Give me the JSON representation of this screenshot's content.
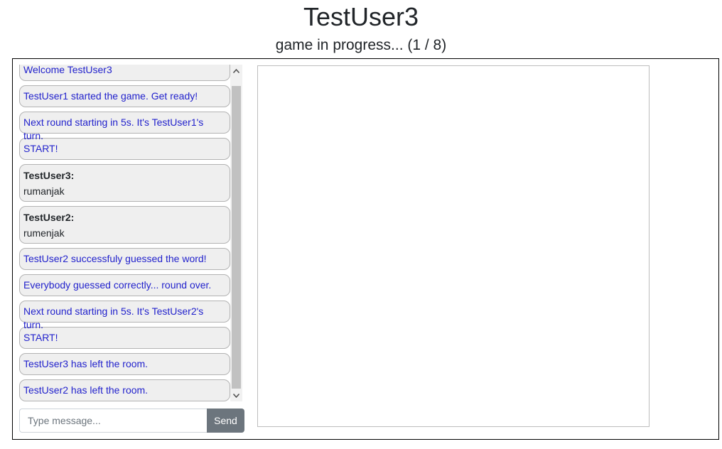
{
  "header": {
    "title": "TestUser3",
    "status": "game in progress... (1 / 8)"
  },
  "chat": {
    "messages": [
      {
        "type": "system",
        "text": "Welcome TestUser3"
      },
      {
        "type": "system",
        "text": "TestUser1 started the game. Get ready!"
      },
      {
        "type": "system",
        "text": "Next round starting in 5s. It's TestUser1's turn."
      },
      {
        "type": "system",
        "text": "START!"
      },
      {
        "type": "user",
        "author": "TestUser3:",
        "text": "rumanjak"
      },
      {
        "type": "user",
        "author": "TestUser2:",
        "text": "rumenjak"
      },
      {
        "type": "system",
        "text": "TestUser2 successfuly guessed the word!"
      },
      {
        "type": "system",
        "text": "Everybody guessed correctly... round over."
      },
      {
        "type": "system",
        "text": "Next round starting in 5s. It's TestUser2's turn."
      },
      {
        "type": "system",
        "text": "START!"
      },
      {
        "type": "system",
        "text": "TestUser3 has left the room."
      },
      {
        "type": "system",
        "text": "TestUser2 has left the room."
      }
    ],
    "input_placeholder": "Type message...",
    "input_value": "",
    "send_label": "Send"
  },
  "colors": {
    "system_text": "#2222cc",
    "bubble_bg": "#efefef",
    "send_button": "#6c757d"
  }
}
